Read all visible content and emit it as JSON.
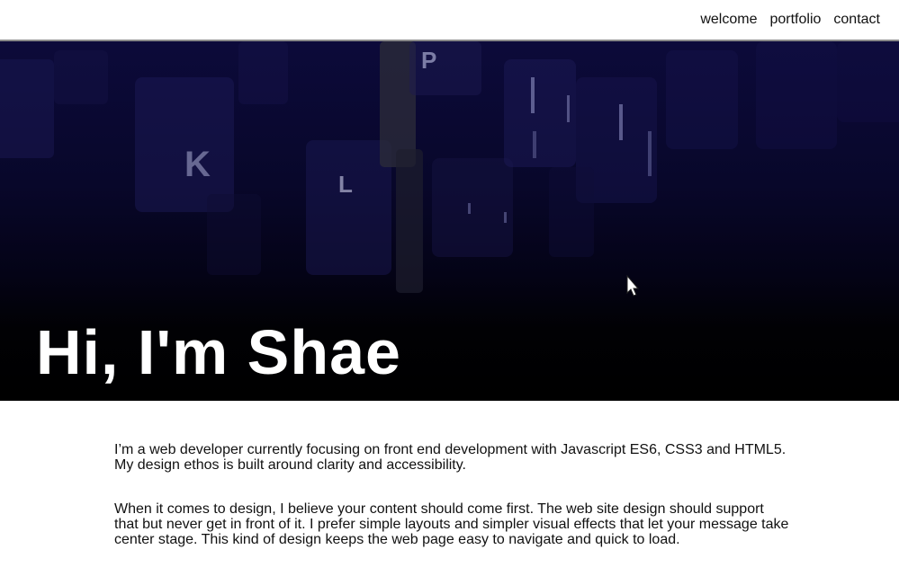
{
  "nav": {
    "items": [
      {
        "label": "welcome"
      },
      {
        "label": "portfolio"
      },
      {
        "label": "contact"
      }
    ]
  },
  "hero": {
    "title": "Hi, I'm Shae",
    "keycaps": [
      "P",
      "K",
      "L"
    ]
  },
  "about": {
    "paragraphs": [
      "I’m a web developer currently focusing on front end development with Javascript ES6, CSS3 and HTML5. My design ethos is built around clarity and accessibility.",
      "When it comes to design, I believe your content should come first. The web site design should support that but never get in front of it. I prefer simple layouts and simpler visual effects that let your message take center stage. This kind of design keeps the web page easy to navigate and quick to load."
    ]
  },
  "colors": {
    "hero_top": "#0c0a3a",
    "hero_bottom": "#000000",
    "text": "#111111"
  }
}
